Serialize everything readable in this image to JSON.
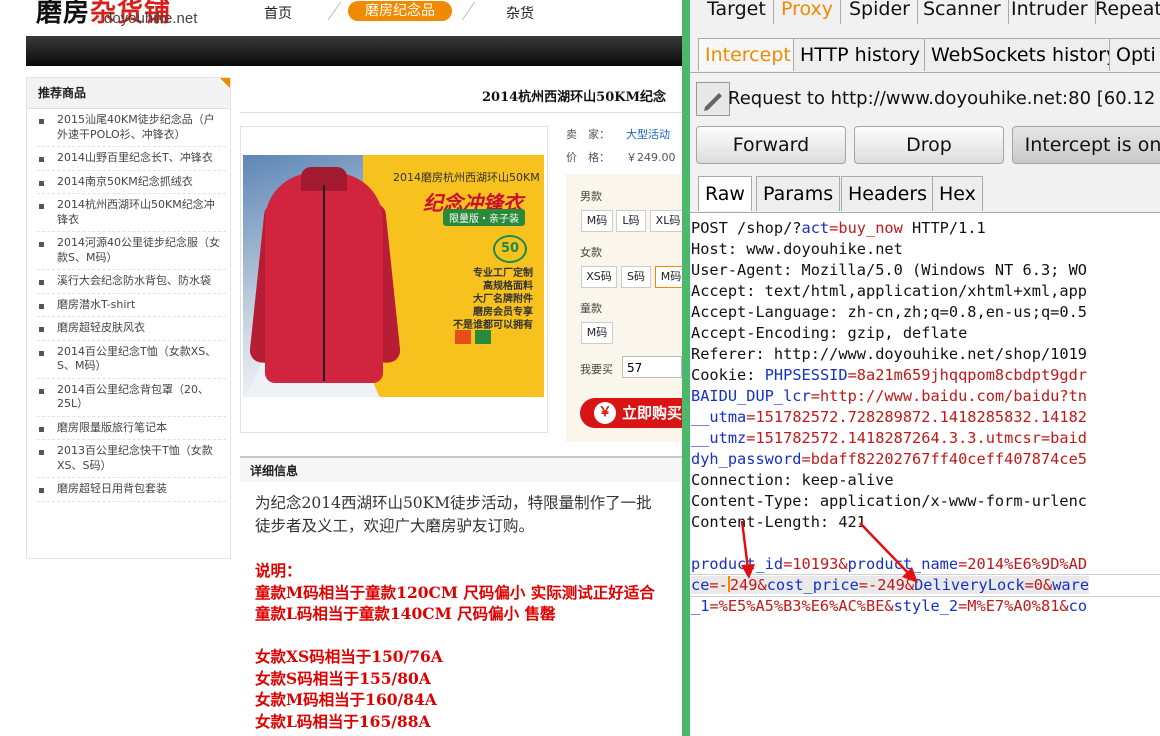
{
  "shop": {
    "logo_main": "磨房",
    "logo_red": "杂货铺",
    "logo_sub": "doyouhike.net",
    "nav": [
      "首页",
      "磨房纪念品",
      "杂货"
    ],
    "sidebar_title": "推荐商品",
    "sidebar_items": [
      "2015汕尾40KM徒步纪念品（户外速干POLO衫、冲锋衣）",
      "2014山野百里纪念长T、冲锋衣",
      "2014南京50KM纪念抓绒衣",
      "2014杭州西湖环山50KM纪念冲锋衣",
      "2014河源40公里徒步纪念服（女款S、M码）",
      "溪行大会纪念防水背包、防水袋",
      "磨房潜水T-shirt",
      "磨房超轻皮肤风衣",
      "2014百公里纪念T恤（女款XS、S、M码）",
      "2014百公里纪念背包罩（20、25L）",
      "磨房限量版旅行笔记本",
      "2013百公里纪念快干T恤（女款XS、S码）",
      "磨房超轻日用背包套装"
    ],
    "product_title": "2014杭州西湖环山50KM纪念",
    "poster": {
      "line1": "2014磨房杭州西湖环山50KM",
      "line2": "纪念冲锋衣",
      "badge": "限量版・亲子装",
      "logo50": "50",
      "specs": "专业工厂定制\n高规格面料\n大厂名牌附件\n磨房会员专享\n不是谁都可以拥有"
    },
    "seller_label": "卖　家：",
    "seller_value": "大型活动",
    "price_label": "价　格：",
    "price_value": "￥249.00",
    "groups": {
      "men": "男款",
      "women": "女款",
      "kids": "童款"
    },
    "men_sizes": [
      "M码",
      "L码",
      "XL码"
    ],
    "women_sizes": [
      "XS码",
      "S码",
      "M码"
    ],
    "kids_sizes": [
      "M码"
    ],
    "qty_label": "我要买",
    "qty_value": "57",
    "buy_label": "立即购买",
    "buy_icon": "￥",
    "detail_head": "详细信息",
    "detail_desc": [
      "为纪念2014西湖环山50KM徒步活动，特限量制作了一批",
      "徒步者及义工，欢迎广大磨房驴友订购。"
    ],
    "detail_red": "说明：\n童款M码相当于童款120CM 尺码偏小 实际测试正好适合\n童款L码相当于童款140CM 尺码偏小 售罄\n\n女款XS码相当于150/76A\n女款S码相当于155/80A\n女款M码相当于160/84A\n女款L码相当于165/88A"
  },
  "burp": {
    "top_tabs": [
      "Target",
      "Proxy",
      "Spider",
      "Scanner",
      "Intruder",
      "Repeat"
    ],
    "sub_tabs": [
      "Intercept",
      "HTTP history",
      "WebSockets history",
      "Opti"
    ],
    "request_text": "Request to http://www.doyouhike.net:80  [60.12",
    "buttons": {
      "forward": "Forward",
      "drop": "Drop",
      "intercept": "Intercept is on"
    },
    "view_tabs": [
      "Raw",
      "Params",
      "Headers",
      "Hex"
    ],
    "lines": {
      "l1a": "POST /shop/?",
      "l1k": "act",
      "l1v": "=buy_now",
      "l1b": " HTTP/1.1",
      "l2": "Host: www.doyouhike.net",
      "l3": "User-Agent: Mozilla/5.0 (Windows NT 6.3; WO",
      "l4": "Accept: text/html,application/xhtml+xml,app",
      "l5": "Accept-Language: zh-cn,zh;q=0.8,en-us;q=0.5",
      "l6": "Accept-Encoding: gzip, deflate",
      "l7": "Referer: http://www.doyouhike.net/shop/1019",
      "l8a": "Cookie: ",
      "l8k": "PHPSESSID",
      "l8v": "=8a21m659jhqqpom8cbdpt9gdr",
      "l9k": "BAIDU_DUP_lcr",
      "l9v": "=http://www.baidu.com/baidu?tn",
      "l10k": "__utma",
      "l10v": "=151782572.728289872.1418285832.14182",
      "l11k": "__utmz",
      "l11v": "=151782572.1418287264.3.3.utmcsr=baid",
      "l12k": "dyh_password",
      "l12v": "=bdaff82202767ff40ceff407874ce5",
      "l13": "Connection: keep-alive",
      "l14": "Content-Type: application/x-www-form-urlenc",
      "l15": "Content-Length: 421",
      "l16k": "product_id",
      "l16v": "=10193&",
      "l16k2": "product_name",
      "l16v2": "=2014%E6%9D%AD",
      "l17k": "ce",
      "l17v": "=-",
      "l17v2": "249&",
      "l17k2": "cost_price",
      "l17v3": "=-249&",
      "l17k3": "DeliveryLock",
      "l17v4": "=0&",
      "l17k4": "ware",
      "l18k": "_1",
      "l18v": "=%E5%A5%B3%E6%AC%BE&",
      "l18k2": "style_2",
      "l18v2": "=M%E7%A0%81&",
      "l18k3": "co"
    }
  },
  "colors": {
    "accent_orange": "#f08a00",
    "link_blue": "#1530c8",
    "value_red": "#c21818",
    "alert_red": "#e00000",
    "divider_green": "#4bb86b"
  }
}
